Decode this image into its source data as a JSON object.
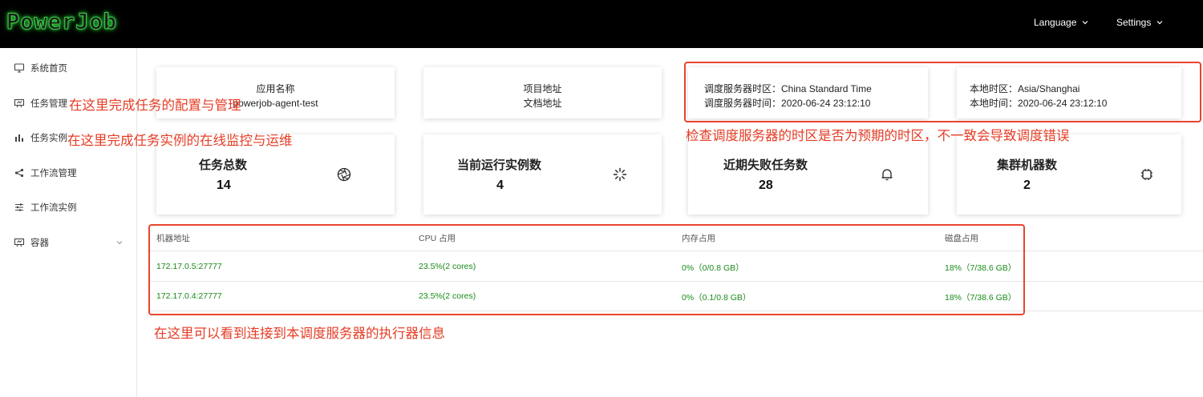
{
  "header": {
    "logo_text": "PowerJob",
    "language_label": "Language",
    "settings_label": "Settings"
  },
  "sidebar": {
    "items": [
      {
        "label": "系统首页",
        "icon": "monitor-icon"
      },
      {
        "label": "任务管理",
        "icon": "presentation-icon"
      },
      {
        "label": "任务实例",
        "icon": "bar-chart-icon"
      },
      {
        "label": "工作流管理",
        "icon": "share-icon"
      },
      {
        "label": "工作流实例",
        "icon": "sliders-icon"
      },
      {
        "label": "容器",
        "icon": "presentation-icon",
        "expandable": true
      }
    ]
  },
  "info_cards": {
    "app": {
      "label": "应用名称",
      "value": "powerjob-agent-test"
    },
    "project": {
      "link1": "项目地址",
      "link2": "文档地址"
    },
    "server_tz": {
      "tz_label": "调度服务器时区：",
      "tz_value": "China Standard Time",
      "time_label": "调度服务器时间：",
      "time_value": "2020-06-24 23:12:10"
    },
    "local_tz": {
      "tz_label": "本地时区：",
      "tz_value": "Asia/Shanghai",
      "time_label": "本地时间：",
      "time_value": "2020-06-24 23:12:10"
    }
  },
  "stats": [
    {
      "title": "任务总数",
      "value": "14",
      "icon": "aperture-icon"
    },
    {
      "title": "当前运行实例数",
      "value": "4",
      "icon": "loading-icon"
    },
    {
      "title": "近期失败任务数",
      "value": "28",
      "icon": "bell-icon"
    },
    {
      "title": "集群机器数",
      "value": "2",
      "icon": "cpu-icon"
    }
  ],
  "workers_table": {
    "columns": [
      "机器地址",
      "CPU 占用",
      "内存占用",
      "磁盘占用"
    ],
    "rows": [
      [
        "172.17.0.5:27777",
        "23.5%(2 cores)",
        "0%（0/0.8 GB）",
        "18%（7/38.6 GB）"
      ],
      [
        "172.17.0.4:27777",
        "23.5%(2 cores)",
        "0%（0.1/0.8 GB）",
        "18%（7/38.6 GB）"
      ]
    ]
  },
  "annotations": {
    "task_mgmt": "在这里完成任务的配置与管理",
    "task_instance": "在这里完成任务实例的在线监控与运维",
    "timezone": "检查调度服务器的时区是否为预期的时区，不一致会导致调度错误",
    "workers": "在这里可以看到连接到本调度服务器的执行器信息"
  },
  "colors": {
    "header_bg": "#000000",
    "logo_green": "#3fd04a",
    "annotation_red": "#e53d26",
    "table_value_green": "#1a8a1a"
  }
}
